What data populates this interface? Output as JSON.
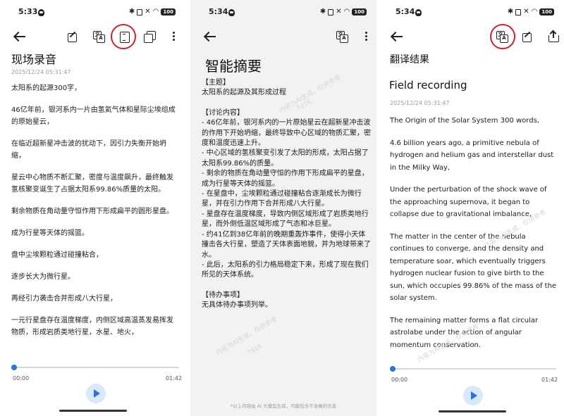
{
  "status_bars": [
    {
      "time": "5:33",
      "battery": "100"
    },
    {
      "time": "5:34",
      "battery": "100"
    },
    {
      "time": "5:34",
      "battery": "100"
    }
  ],
  "recording": {
    "title": "现场录音",
    "date": "2025/12/24 05:31:47",
    "paragraphs": [
      "太阳系的起源300字，",
      "46亿年前，银河系内一片由氢氦气体和星际尘埃组成的原始星云，",
      "在临近超新星冲击波的扰动下，因引力失衡开始坍缩，",
      "星云中心物质不断汇聚，密度与温度飙升，最终触发氢核聚变诞生了占据太阳系99.86%质量的太阳。",
      "剩余物质在角动量守恒作用下形成扁平的圆形星盘。",
      "成为行星等天体的摇篮。",
      "盘中尘埃颗粒通过碰撞粘合，",
      "逐步长大为微行星。",
      "再经引力袭击合并形成八大行星，",
      "一元行星盘存在温度梯度，内侧区域高温蒸发易挥发物质，形成岩质类地行星，水星、地火，"
    ],
    "player": {
      "current": "00:00",
      "total": "01:42",
      "progress": 0
    }
  },
  "summary": {
    "title": "智能摘要",
    "topic_header": "【主题】",
    "topic": "太阳系的起源及其形成过程",
    "discussion_header": "【讨论内容】",
    "discussion": [
      "- 46亿年前，银河系内的一片原始星云在超新星冲击波的作用下开始坍缩，最终导致中心区域的物质汇聚，密度和温度迅速上升。",
      "- 中心区域的氢核聚变引发了太阳的形成，太阳占据了太阳系99.86%的质量。",
      "- 剩余的物质在角动量守恒的作用下形成扁平的星盘，成为行星等天体的摇篮。",
      "- 在星盘中，尘埃颗粒通过碰撞粘合逐渐成长为微行星，并在引力作用下合并形成八大行星。",
      "- 星盘存在温度梯度，导致内侧区域形成了岩质类地行星，而外侧低温区域形成了气态和冰巨星。",
      "- 约41亿到38亿年前的晚期重轰炸事件，使得小天体撞击各大行星，塑造了天体表面地貌，并为地球带来了水。",
      "- 此后，太阳系的引力格局稳定下来，形成了现在我们所见的天体系统。"
    ],
    "todo_header": "【待办事项】",
    "todo": "无具体待办事项列举。",
    "disclaimer": "*以上内容由 AI 大模型生成，可能包含不准确的信息"
  },
  "translation": {
    "header": "翻译结果",
    "title": "Field recording",
    "date": "2025/12/24 05:31:47",
    "paragraphs": [
      "The Origin of the Solar System 300 words,",
      "4.6 billion years ago, a primitive nebula of hydrogen and helium gas and interstellar dust in the Milky Way,",
      "Under the perturbation of the shock wave of the approaching supernova, it began to collapse due to gravitational imbalance,",
      "The matter in the center of the nebula continues to converge, and the density and temperature soar, which eventually triggers hydrogen nuclear fusion to give birth to the sun, which occupies 99.86% of the mass of the solar system.",
      "The remaining matter forms a flat circular astrolabe under the action of angular momentum conservation."
    ],
    "player": {
      "current": "00:00",
      "total": "01:42",
      "progress": 0
    }
  },
  "watermark": "内容为AI生成，仅供参考",
  "watermark_tag": "7d1K",
  "colors": {
    "accent": "#2a72e0",
    "highlight": "#d0202a"
  }
}
